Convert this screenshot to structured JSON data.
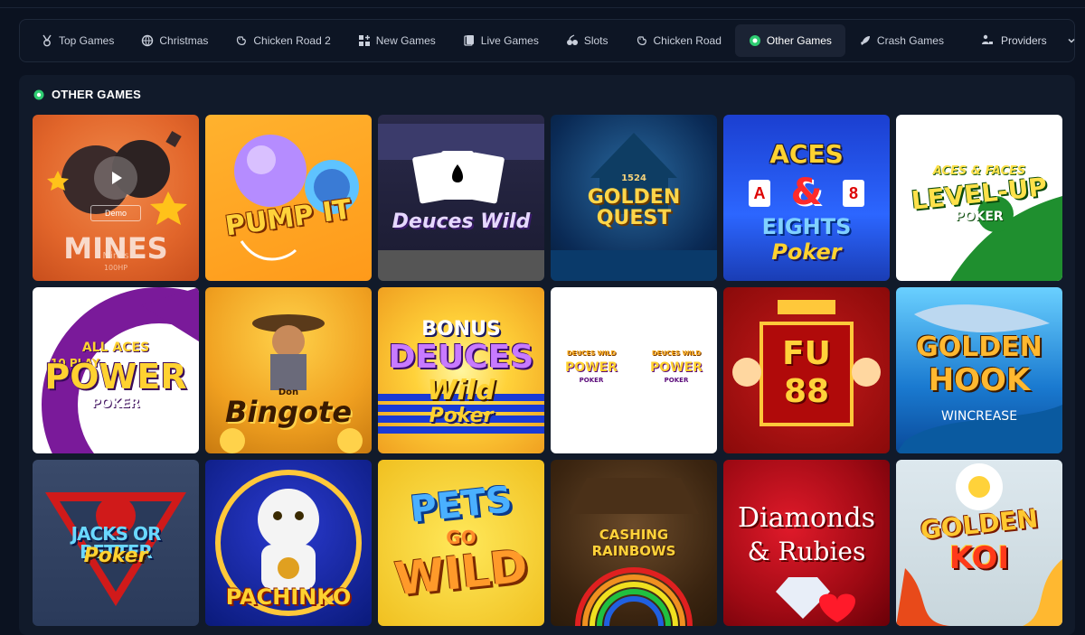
{
  "tabs": [
    {
      "label": "Top Games",
      "icon": "top-games-icon"
    },
    {
      "label": "Christmas",
      "icon": "globe-icon"
    },
    {
      "label": "Chicken Road 2",
      "icon": "chicken-icon"
    },
    {
      "label": "New Games",
      "icon": "new-games-icon"
    },
    {
      "label": "Live Games",
      "icon": "live-games-icon"
    },
    {
      "label": "Slots",
      "icon": "slots-icon"
    },
    {
      "label": "Chicken Road",
      "icon": "chicken-icon"
    },
    {
      "label": "Other Games",
      "icon": "other-games-icon",
      "active": true
    },
    {
      "label": "Crash Games",
      "icon": "rocket-icon"
    }
  ],
  "providers": {
    "label": "Providers",
    "icon": "providers-icon"
  },
  "section": {
    "title": "OTHER GAMES",
    "icon": "other-games-icon"
  },
  "games": [
    {
      "title": "MINES",
      "demo": "Demo",
      "name": "Mines",
      "meta": "100HP"
    },
    {
      "title": "PUMP IT"
    },
    {
      "title": "Deuces Wild"
    },
    {
      "title": "GOLDEN QUEST",
      "year": "1524"
    },
    {
      "title": "ACES & EIGHTS Poker",
      "t1": "ACES",
      "t2": "&",
      "t3": "EIGHTS",
      "t4": "Poker",
      "cardA": "A",
      "card8": "8"
    },
    {
      "title": "ACES & FACES LEVEL-UP POKER",
      "t1": "ACES & FACES",
      "t2": "LEVEL-UP",
      "t3": "POKER"
    },
    {
      "title": "ALL ACES 10 PLAY POWER POKER",
      "t1": "ALL ACES",
      "t2": "10 PLAY",
      "t3": "POWER",
      "t4": "POKER"
    },
    {
      "title": "Don Bingote",
      "t1": "Don",
      "t2": "Bingote"
    },
    {
      "title": "BONUS DEUCES Wild Poker",
      "t1": "BONUS",
      "t2": "DEUCES",
      "t3": "Wild",
      "t4": "Poker"
    },
    {
      "title": "DEUCES WILD POWER POKER",
      "t1": "DEUCES WILD",
      "t2": "POWER",
      "t3": "POKER"
    },
    {
      "title": "FU 88",
      "t1": "FU",
      "t2": "88"
    },
    {
      "title": "GOLDEN HOOK WINCREASE",
      "t1": "GOLDEN",
      "t2": "HOOK",
      "t3": "WINCREASE"
    },
    {
      "title": "JACKS OR BETTER Poker",
      "t1": "JACKS OR BETTER",
      "t2": "Poker"
    },
    {
      "title": "PACHINKO"
    },
    {
      "title": "PETS GO WILD",
      "t1": "PETS",
      "t2": "GO",
      "t3": "WILD"
    },
    {
      "title": "CASHING RAINBOWS"
    },
    {
      "title": "Diamonds & Rubies",
      "t1": "Diamonds",
      "t2": "& Rubies"
    },
    {
      "title": "GOLDEN KOI",
      "t1": "GOLDEN",
      "t2": "KOI"
    }
  ],
  "colors": {
    "bg": "#0b1220",
    "panel": "#111a2a",
    "active_tab": "#1b2334",
    "accent_green": "#2ecc71"
  }
}
